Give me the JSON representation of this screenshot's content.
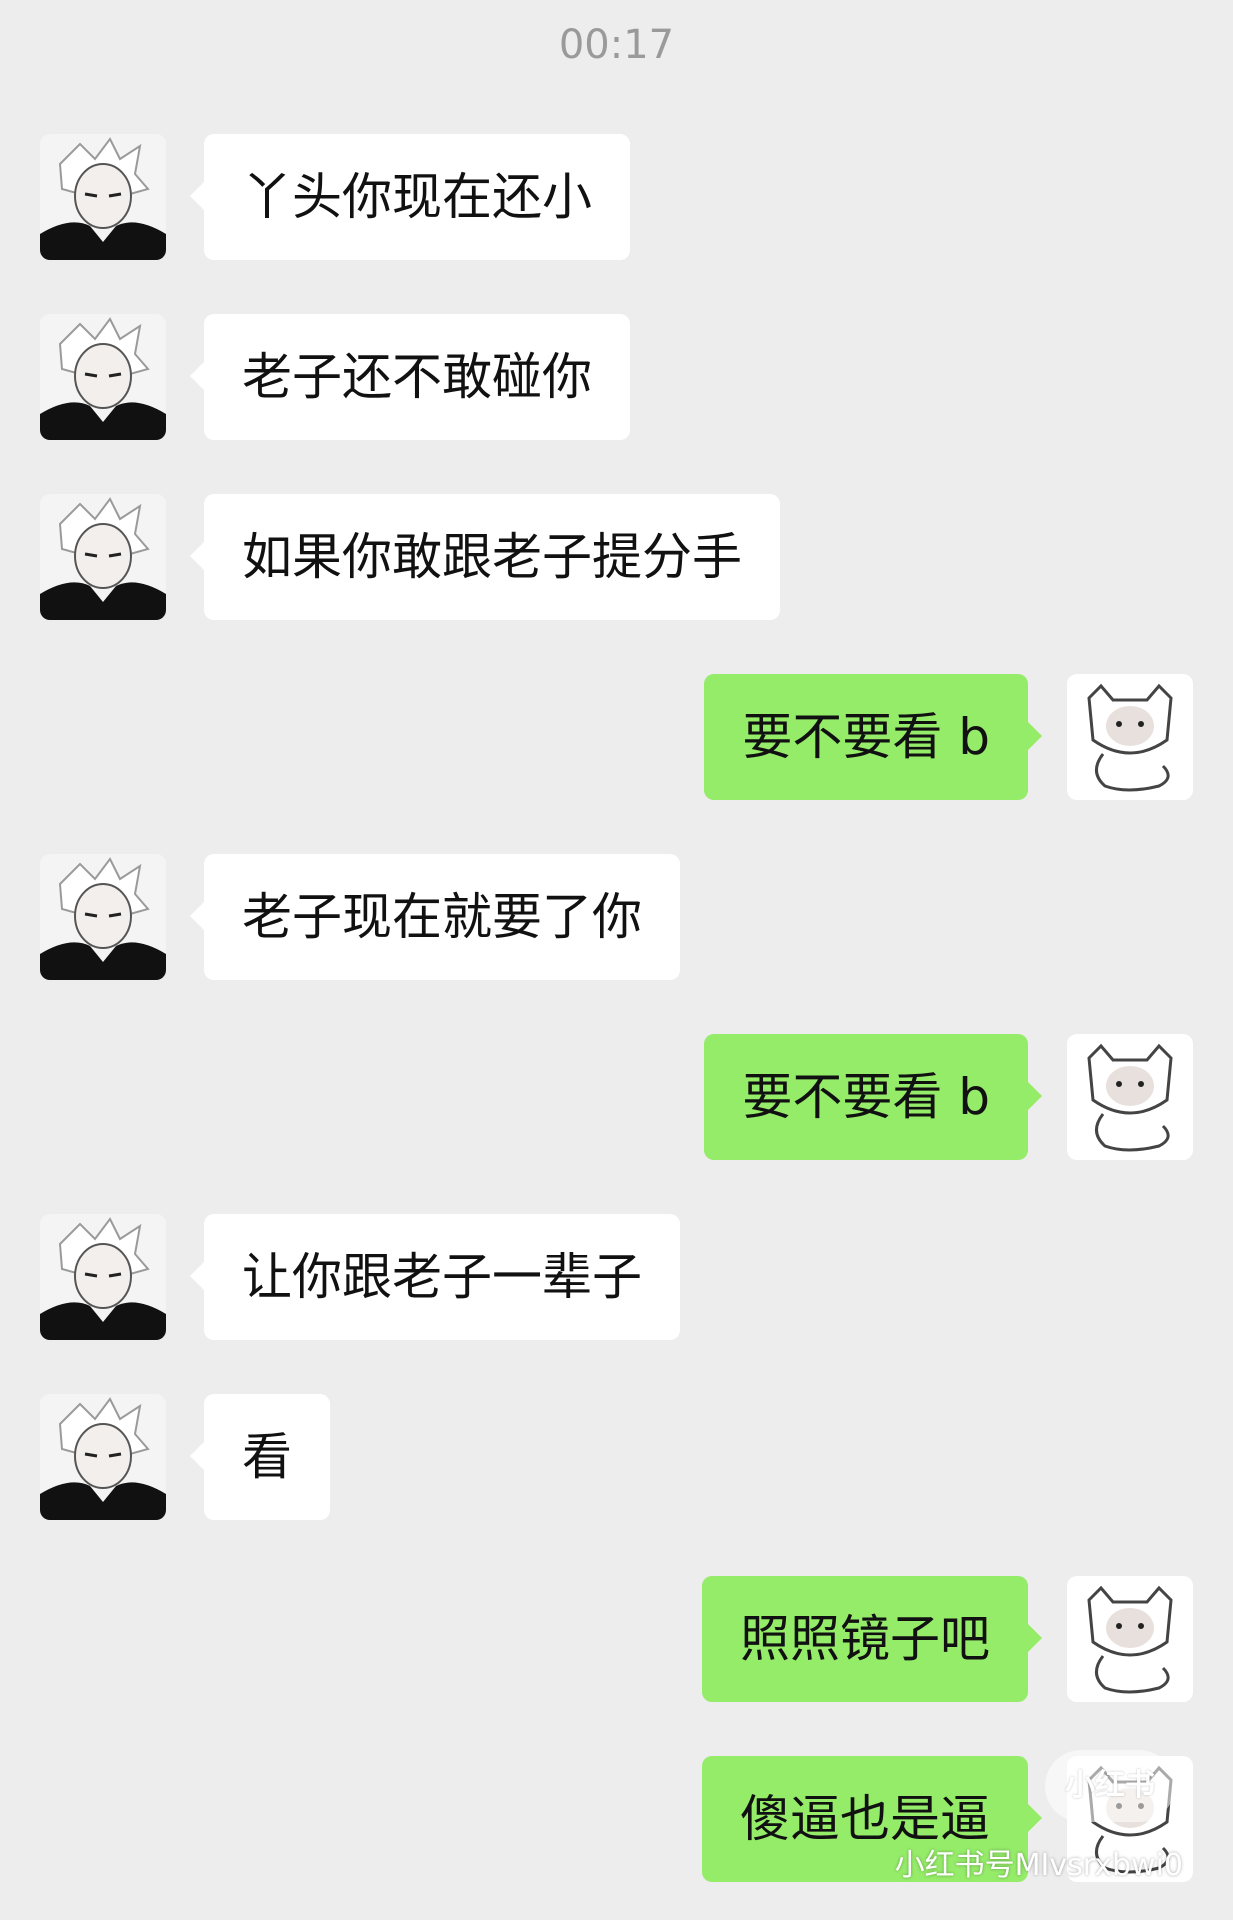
{
  "chat": {
    "timestamp": "00:17",
    "messages": [
      {
        "side": "in",
        "text": "丫头你现在还小"
      },
      {
        "side": "in",
        "text": "老子还不敢碰你"
      },
      {
        "side": "in",
        "text": "如果你敢跟老子提分手"
      },
      {
        "side": "out",
        "text": "要不要看 b"
      },
      {
        "side": "in",
        "text": "老子现在就要了你"
      },
      {
        "side": "out",
        "text": "要不要看 b"
      },
      {
        "side": "in",
        "text": "让你跟老子一辈子"
      },
      {
        "side": "in",
        "text": "看"
      },
      {
        "side": "out",
        "text": "照照镜子吧"
      },
      {
        "side": "out",
        "text": "傻逼也是逼"
      }
    ]
  },
  "avatars": {
    "left": "anime-boy-avatar",
    "right": "cartoon-cat-avatar"
  },
  "watermark": {
    "logo": "小红书",
    "id": "小红书号MIvsrxbwi0"
  },
  "colors": {
    "background": "#ededed",
    "bubble_in": "#ffffff",
    "bubble_out": "#95ec69",
    "timestamp": "#9a9a9a"
  }
}
